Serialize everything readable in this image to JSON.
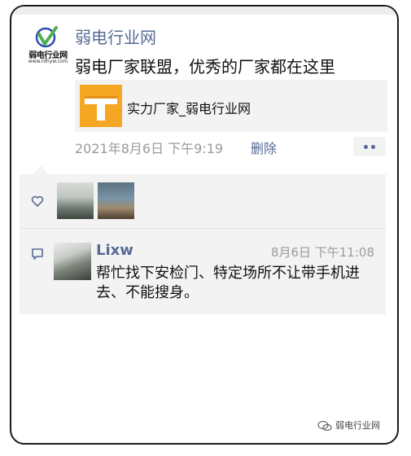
{
  "post": {
    "author": "弱电行业网",
    "logo_name": "弱电行业网",
    "logo_url": "www.rdhyw.com",
    "text": "弱电厂家联盟，优秀的厂家都在这里",
    "link_card": {
      "title": "实力厂家_弱电行业网",
      "thumb_color": "#f5a623"
    },
    "timestamp": "2021年8月6日 下午9:19",
    "delete_label": "删除"
  },
  "interactions": {
    "likes_icon": "heart-icon",
    "comment": {
      "author": "Lixw",
      "time": "8月6日 下午11:08",
      "text": "帮忙找下安检门、特定场所不让带手机进去、不能搜身。"
    }
  },
  "watermark": {
    "text": "弱电行业网"
  },
  "colors": {
    "link_blue": "#576b95",
    "gray": "#9b9b9b",
    "panel_bg": "#f3f3f3"
  }
}
